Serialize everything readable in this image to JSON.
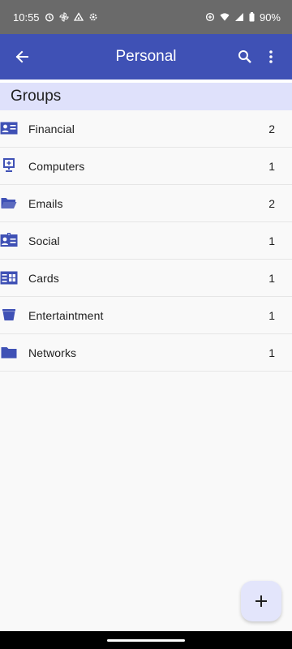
{
  "status_bar": {
    "time": "10:55",
    "battery_percent": "90%",
    "left_icons": [
      "alarm-icon",
      "pinwheel-icon",
      "drive-icon",
      "settings-icon"
    ],
    "right_icons": [
      "data-saver-icon",
      "wifi-icon",
      "signal-icon",
      "battery-icon"
    ]
  },
  "app_bar": {
    "title": "Personal",
    "background_color": "#3f51b5",
    "icons": [
      "back-arrow-icon",
      "search-icon",
      "more-vert-icon"
    ]
  },
  "section": {
    "header": "Groups",
    "background_color": "#dfe1fb"
  },
  "groups": [
    {
      "label": "Financial",
      "count": "2",
      "icon": "contact-card-icon"
    },
    {
      "label": "Computers",
      "count": "1",
      "icon": "computer-icon"
    },
    {
      "label": "Emails",
      "count": "2",
      "icon": "folder-open-icon"
    },
    {
      "label": "Social",
      "count": "1",
      "icon": "id-badge-icon"
    },
    {
      "label": "Cards",
      "count": "1",
      "icon": "card-chip-icon"
    },
    {
      "label": "Entertaintment",
      "count": "1",
      "icon": "bucket-icon"
    },
    {
      "label": "Networks",
      "count": "1",
      "icon": "folder-icon"
    }
  ],
  "fab": {
    "icon": "plus-icon"
  },
  "accent_color": "#3f51b5"
}
